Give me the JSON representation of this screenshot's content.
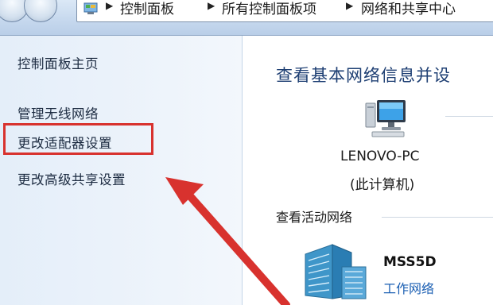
{
  "breadcrumb": [
    "控制面板",
    "所有控制面板项",
    "网络和共享中心"
  ],
  "sidebar": {
    "items": [
      {
        "label": "控制面板主页"
      },
      {
        "label": "管理无线网络"
      },
      {
        "label": "更改适配器设置",
        "highlighted": true
      },
      {
        "label": "更改高级共享设置"
      }
    ]
  },
  "main": {
    "heading": "查看基本网络信息并设",
    "computer": {
      "name": "LENOVO-PC",
      "subtitle": "(此计算机)"
    },
    "active_networks_label": "查看活动网络",
    "network": {
      "name": "MSS5D",
      "type": "工作网络"
    }
  },
  "annotation": {
    "color": "#d8322e"
  },
  "colors": {
    "heading": "#1e3f73",
    "link": "#1b5fb3"
  }
}
